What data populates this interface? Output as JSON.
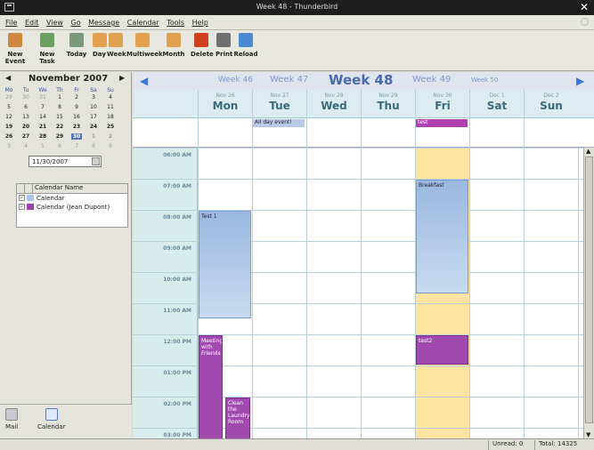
{
  "window": {
    "title": "Week 48 - Thunderbird"
  },
  "menu": [
    "File",
    "Edit",
    "View",
    "Go",
    "Message",
    "Calendar",
    "Tools",
    "Help"
  ],
  "toolbar": [
    {
      "label": "New Event",
      "icon": "new-event-icon",
      "color": "#d08840"
    },
    {
      "label": "New Task",
      "icon": "new-task-icon",
      "color": "#6aa060"
    },
    {
      "label": "Today",
      "icon": "today-icon",
      "color": "#7a9a7a"
    },
    {
      "label": "Day",
      "icon": "day-view-icon",
      "color": "#e0a050"
    },
    {
      "label": "Week",
      "icon": "week-view-icon",
      "color": "#e0a050"
    },
    {
      "label": "Multiweek",
      "icon": "multiweek-view-icon",
      "color": "#e0a050"
    },
    {
      "label": "Month",
      "icon": "month-view-icon",
      "color": "#e0a050"
    },
    {
      "label": "Delete",
      "icon": "delete-icon",
      "color": "#d04020"
    },
    {
      "label": "Print",
      "icon": "print-icon",
      "color": "#707070"
    },
    {
      "label": "Reload",
      "icon": "reload-icon",
      "color": "#4a8ad0"
    }
  ],
  "minimonth": {
    "title": "November  2007",
    "dows": [
      "Mo",
      "Tu",
      "We",
      "Th",
      "Fr",
      "Sa",
      "Su"
    ],
    "weeks": [
      [
        "29",
        "30",
        "31",
        "1",
        "2",
        "3",
        "4"
      ],
      [
        "5",
        "6",
        "7",
        "8",
        "9",
        "10",
        "11"
      ],
      [
        "12",
        "13",
        "14",
        "15",
        "16",
        "17",
        "18"
      ],
      [
        "19",
        "20",
        "21",
        "22",
        "23",
        "24",
        "25"
      ],
      [
        "26",
        "27",
        "28",
        "29",
        "30",
        "1",
        "2"
      ],
      [
        "3",
        "4",
        "5",
        "6",
        "7",
        "8",
        "9"
      ]
    ],
    "date_field": "11/30/2007"
  },
  "calendar_list": {
    "header": "Calendar Name",
    "items": [
      {
        "name": "Calendar",
        "color": "#a8c8e8"
      },
      {
        "name": "Calendar (Jean Dupont)",
        "color": "#a040b0"
      }
    ]
  },
  "modes": [
    {
      "label": "Mail",
      "icon": "mail-icon"
    },
    {
      "label": "Calendar",
      "icon": "calendar-icon"
    }
  ],
  "weeknav": {
    "weeks": [
      "Week 46",
      "Week 47",
      "Week 48",
      "Week 49",
      "Week 50"
    ]
  },
  "days": [
    {
      "date": "Nov 26",
      "name": "Mon"
    },
    {
      "date": "Nov 27",
      "name": "Tue"
    },
    {
      "date": "Nov 28",
      "name": "Wed"
    },
    {
      "date": "Nov 29",
      "name": "Thu"
    },
    {
      "date": "Nov 30",
      "name": "Fri"
    },
    {
      "date": "Dec 1",
      "name": "Sat"
    },
    {
      "date": "Dec 2",
      "name": "Sun"
    }
  ],
  "allday_events": [
    {
      "day": 1,
      "title": "All day event!",
      "color": "#b8c8e8",
      "text_color": "#223"
    },
    {
      "day": 4,
      "title": "test",
      "color": "#b040b0",
      "text_color": "#fff"
    }
  ],
  "times": [
    "06:00 AM",
    "07:00 AM",
    "08:00 AM",
    "09:00 AM",
    "10:00 AM",
    "11:00 AM",
    "12:00 PM",
    "01:00 PM",
    "02:00 PM",
    "03:00 PM"
  ],
  "events": [
    {
      "title": "Test 1",
      "day": 0,
      "start": 8,
      "end": 11.5,
      "style": "blue"
    },
    {
      "title": "Breakfast",
      "day": 4,
      "start": 7,
      "end": 10.7,
      "style": "blue"
    },
    {
      "title": "Meeting with Friends",
      "day": 0,
      "start": 12,
      "end": 15.5,
      "style": "purple"
    },
    {
      "title": "test2",
      "day": 4,
      "start": 12,
      "end": 13,
      "style": "purple"
    },
    {
      "title": "Clean the Laundry Room",
      "day": 0.5,
      "start": 14,
      "end": 15.5,
      "style": "purple"
    }
  ],
  "highlight_day": 4,
  "highlight_color": "#fce4a0",
  "status": {
    "unread": "Unread: 0",
    "total": "Total: 14325"
  }
}
